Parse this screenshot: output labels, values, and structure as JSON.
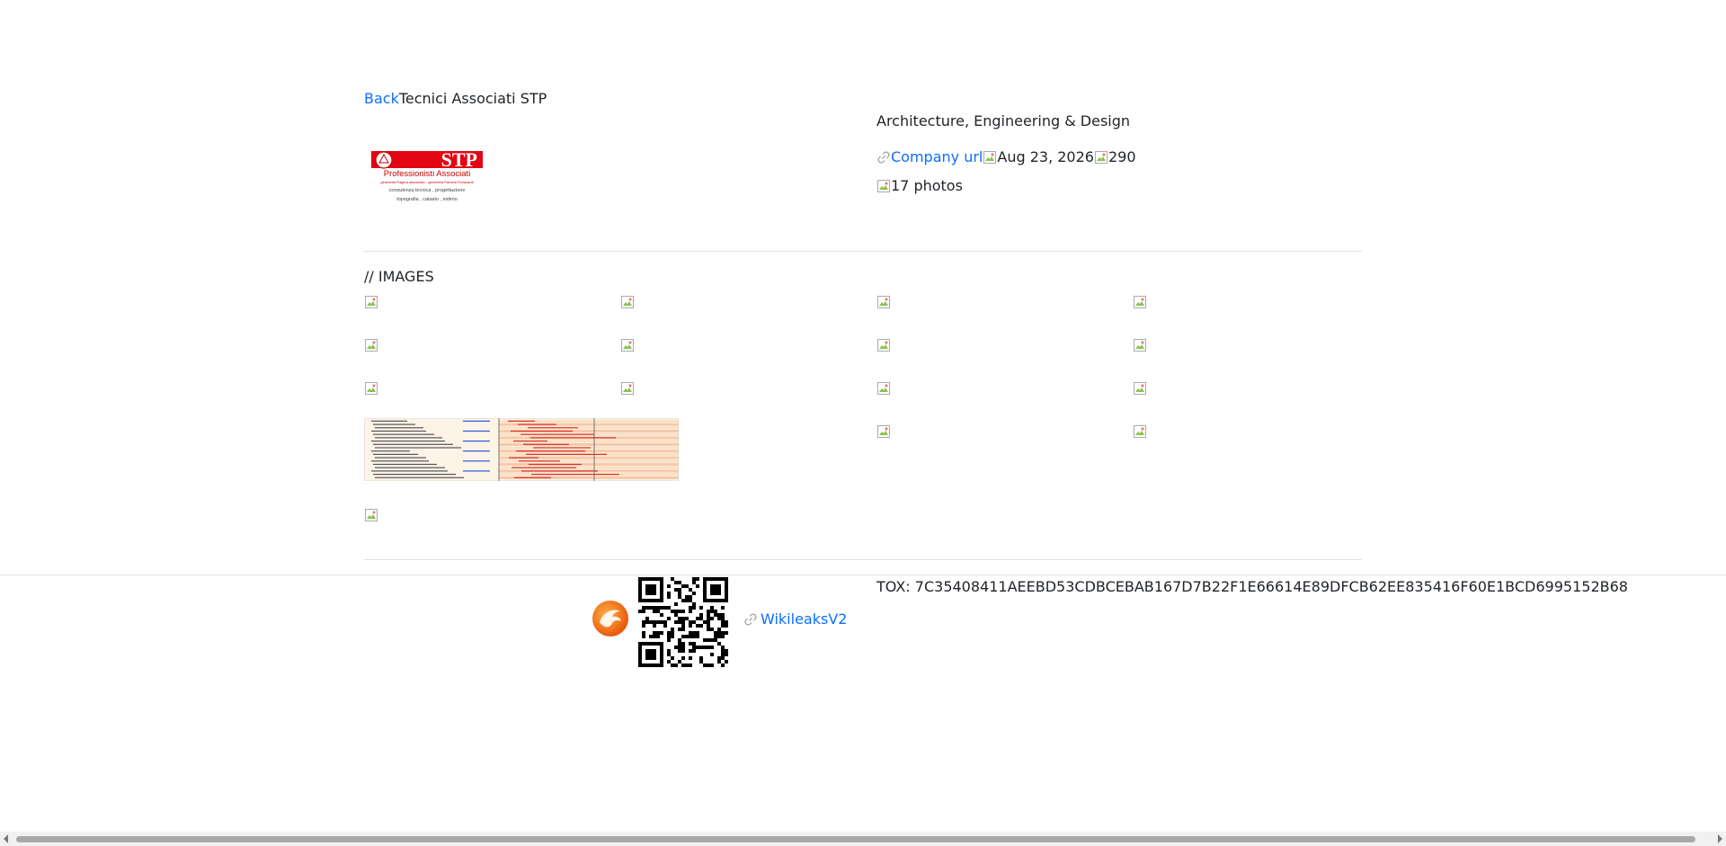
{
  "header": {
    "back_label": "Back",
    "company_name": "Tecnici Associati STP"
  },
  "logo": {
    "brand": "STP",
    "line1": "Professionisti Associati",
    "line2": "geometra Pagina associatio - geometra Pamela Fioravanti",
    "line3": "consulenza tecnica , progettazione",
    "line4": "topografia , catasto , estimo"
  },
  "details": {
    "category": "Architecture, Engineering & Design",
    "company_url_label": "Company url",
    "date": "Aug 23, 2026",
    "views": "290",
    "photos": "17 photos"
  },
  "images_section": {
    "title": "// IMAGES"
  },
  "footer": {
    "tox": "TOX: 7C35408411AEEBD53CDBCEBAB167D7B22F1E66614E89DFCB62EE835416F60E1BCD6995152B68",
    "link_label": "WikileaksV2"
  },
  "colors": {
    "link": "#0d6efd",
    "logo_red": "#e30613",
    "divider": "#dee2e6"
  }
}
